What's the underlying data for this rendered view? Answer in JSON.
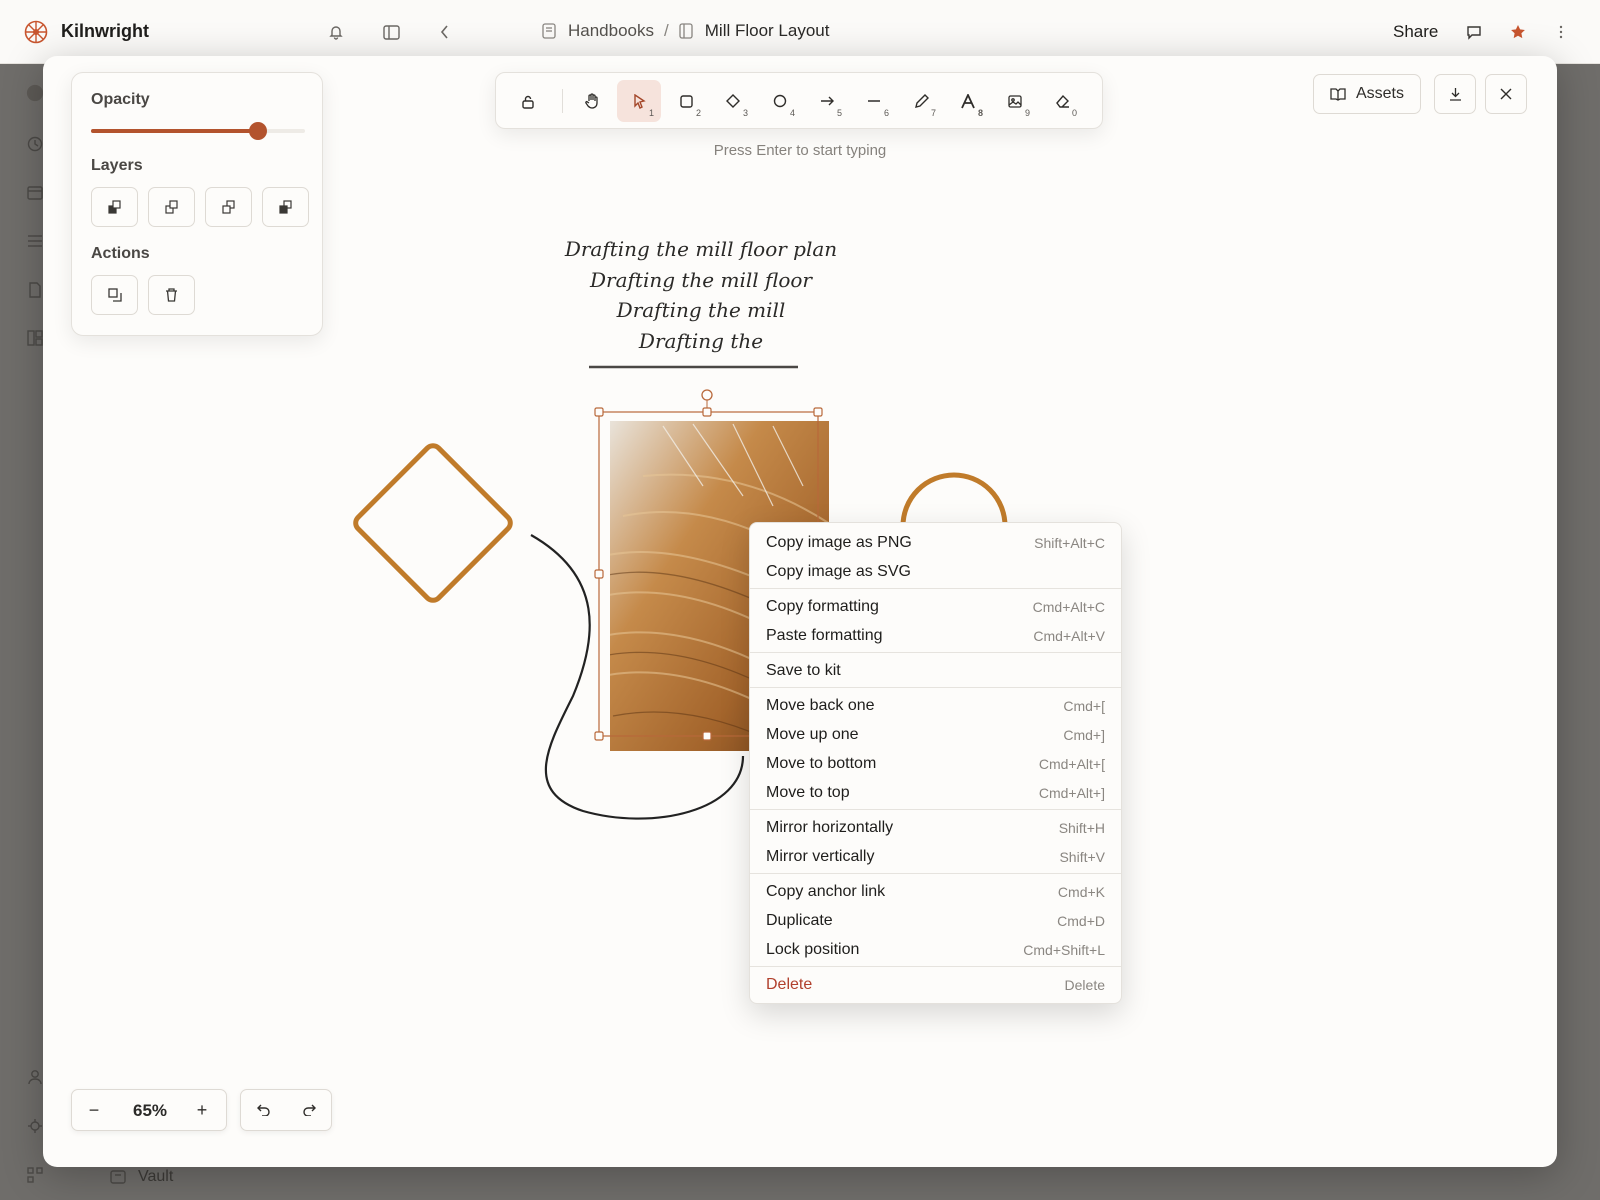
{
  "app": {
    "name": "Kilnwright"
  },
  "breadcrumb": {
    "parent": "Handbooks",
    "separator": "/",
    "current": "Mill Floor Layout"
  },
  "header": {
    "share_label": "Share"
  },
  "sidebar": {
    "bottom_item": "Vault"
  },
  "panel": {
    "opacity_label": "Opacity",
    "opacity_value": 0.78,
    "layers_label": "Layers",
    "actions_label": "Actions"
  },
  "toolbar": {
    "tools": [
      {
        "icon": "lock-icon",
        "key": ""
      },
      {
        "icon": "hand-icon",
        "key": ""
      },
      {
        "icon": "pointer-icon",
        "key": "1"
      },
      {
        "icon": "rectangle-icon",
        "key": "2"
      },
      {
        "icon": "diamond-icon",
        "key": "3"
      },
      {
        "icon": "ellipse-icon",
        "key": "4"
      },
      {
        "icon": "arrow-icon",
        "key": "5"
      },
      {
        "icon": "line-icon",
        "key": "6"
      },
      {
        "icon": "pencil-icon",
        "key": "7"
      },
      {
        "icon": "text-icon",
        "key": "8"
      },
      {
        "icon": "image-icon",
        "key": "9"
      },
      {
        "icon": "eraser-icon",
        "key": "0"
      }
    ],
    "hint": "Press Enter to start typing"
  },
  "top_right": {
    "assets_label": "Assets"
  },
  "canvas": {
    "text_lines": [
      "Drafting the mill floor plan",
      "Drafting the mill floor",
      "Drafting the mill",
      "Drafting the"
    ],
    "accent_color": "#c07b2a"
  },
  "context_menu": {
    "groups": [
      [
        {
          "label": "Copy image as PNG",
          "shortcut": "Shift+Alt+C"
        },
        {
          "label": "Copy image as SVG",
          "shortcut": ""
        }
      ],
      [
        {
          "label": "Copy formatting",
          "shortcut": "Cmd+Alt+C"
        },
        {
          "label": "Paste formatting",
          "shortcut": "Cmd+Alt+V"
        }
      ],
      [
        {
          "label": "Save to kit",
          "shortcut": ""
        }
      ],
      [
        {
          "label": "Move back one",
          "shortcut": "Cmd+["
        },
        {
          "label": "Move up one",
          "shortcut": "Cmd+]"
        },
        {
          "label": "Move to bottom",
          "shortcut": "Cmd+Alt+["
        },
        {
          "label": "Move to top",
          "shortcut": "Cmd+Alt+]"
        }
      ],
      [
        {
          "label": "Mirror horizontally",
          "shortcut": "Shift+H"
        },
        {
          "label": "Mirror vertically",
          "shortcut": "Shift+V"
        }
      ],
      [
        {
          "label": "Copy anchor link",
          "shortcut": "Cmd+K"
        },
        {
          "label": "Duplicate",
          "shortcut": "Cmd+D"
        },
        {
          "label": "Lock position",
          "shortcut": "Cmd+Shift+L"
        }
      ],
      [
        {
          "label": "Delete",
          "shortcut": "Delete",
          "danger": true
        }
      ]
    ]
  },
  "zoom": {
    "value": "65%",
    "minus": "−",
    "plus": "+"
  }
}
